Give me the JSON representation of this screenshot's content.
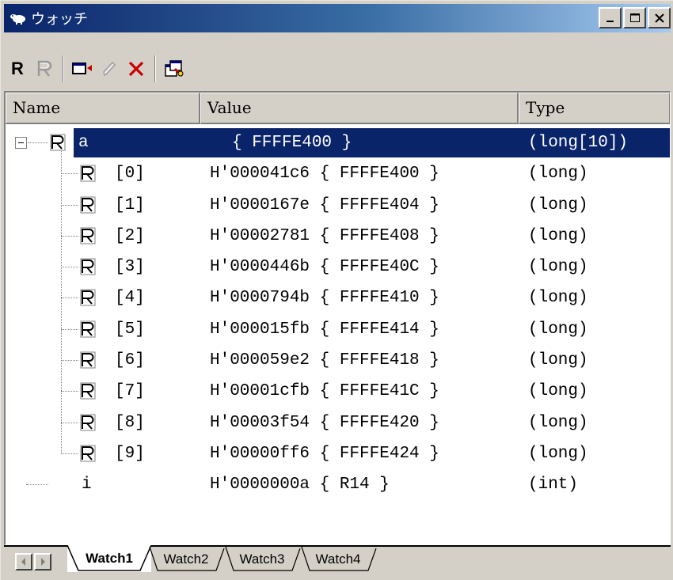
{
  "window": {
    "title": "ウォッチ",
    "minimize_label": "_",
    "maximize_label": "□",
    "close_label": "×"
  },
  "toolbar": {
    "icons": [
      "register-bold-icon",
      "register-gray-icon",
      "add-watch-icon",
      "edit-pencil-icon",
      "delete-x-icon",
      "settings-icon"
    ],
    "bold_label": "R",
    "gray_label": "R"
  },
  "columns": {
    "name": "Name",
    "value": "Value",
    "type": "Type"
  },
  "rows": [
    {
      "name": "a",
      "value": "{ FFFFE400 }",
      "type": "(long[10])",
      "selected": true
    },
    {
      "name": "[0]",
      "value": "H'000041c6 { FFFFE400 }",
      "type": "(long)"
    },
    {
      "name": "[1]",
      "value": "H'0000167e { FFFFE404 }",
      "type": "(long)"
    },
    {
      "name": "[2]",
      "value": "H'00002781 { FFFFE408 }",
      "type": "(long)"
    },
    {
      "name": "[3]",
      "value": "H'0000446b { FFFFE40C }",
      "type": "(long)"
    },
    {
      "name": "[4]",
      "value": "H'0000794b { FFFFE410 }",
      "type": "(long)"
    },
    {
      "name": "[5]",
      "value": "H'000015fb { FFFFE414 }",
      "type": "(long)"
    },
    {
      "name": "[6]",
      "value": "H'000059e2 { FFFFE418 }",
      "type": "(long)"
    },
    {
      "name": "[7]",
      "value": "H'00001cfb { FFFFE41C }",
      "type": "(long)"
    },
    {
      "name": "[8]",
      "value": "H'00003f54 { FFFFE420 }",
      "type": "(long)"
    },
    {
      "name": "[9]",
      "value": "H'00000ff6 { FFFFE424 }",
      "type": "(long)"
    },
    {
      "name": "i",
      "value": "H'0000000a { R14 }",
      "type": "(int)"
    }
  ],
  "tabs": [
    {
      "label": "Watch1",
      "active": true
    },
    {
      "label": "Watch2",
      "active": false
    },
    {
      "label": "Watch3",
      "active": false
    },
    {
      "label": "Watch4",
      "active": false
    }
  ],
  "colors": {
    "selection": "#0a246a",
    "title_gradient_start": "#0a246a",
    "title_gradient_end": "#a6caf0",
    "face": "#d4d0c8"
  }
}
